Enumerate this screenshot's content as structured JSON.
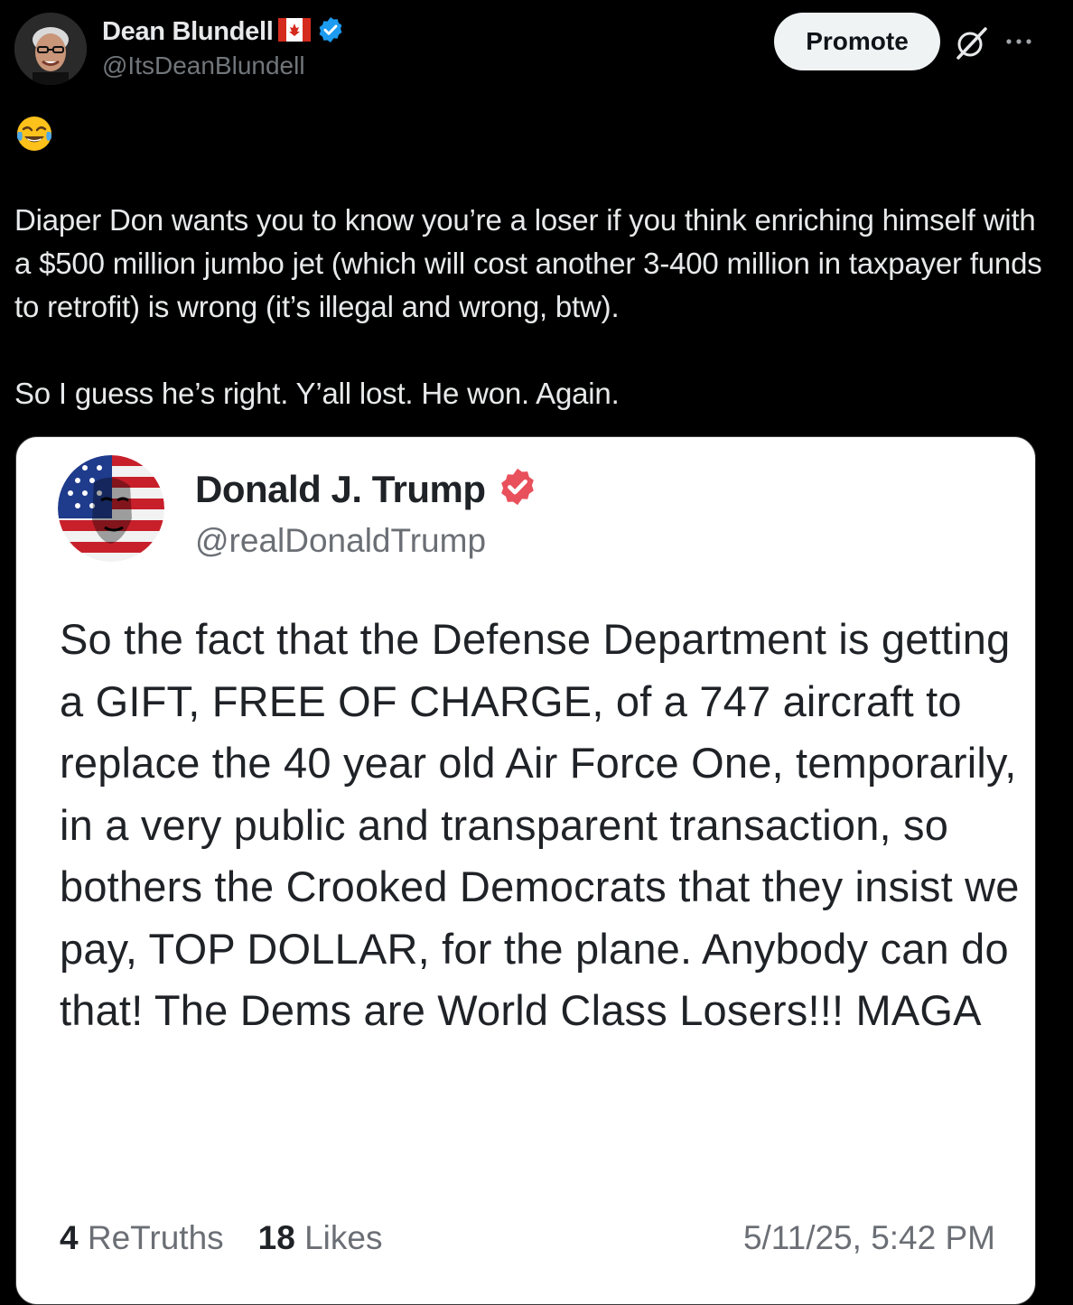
{
  "post": {
    "author_name": "Dean Blundell",
    "author_handle": "@ItsDeanBlundell",
    "promote_label": "Promote",
    "emoji": "😂",
    "paragraph_1": "Diaper Don wants you to know you’re a loser if you think enriching himself with a $500 million jumbo jet (which will cost another 3-400 million in taxpayer funds to retrofit) is wrong (it’s illegal and wrong, btw).",
    "paragraph_2": "So I guess he’s right. Y’all lost. He won. Again."
  },
  "quoted": {
    "author_name": "Donald J. Trump",
    "author_handle": "@realDonaldTrump",
    "text": "So the fact that the Defense Department is getting a GIFT, FREE OF CHARGE, of a 747 aircraft to replace the 40 year old Air Force One, temporarily, in a very public and transparent transaction, so bothers the Crooked Democrats that they insist we pay, TOP DOLLAR, for the plane. Anybody can do that! The Dems are World Class Losers!!! MAGA",
    "retruths_count": "4",
    "retruths_label": "ReTruths",
    "likes_count": "18",
    "likes_label": "Likes",
    "timestamp": "5/11/25, 5:42 PM"
  },
  "colors": {
    "background": "#000000",
    "verified_blue": "#1d9bf0",
    "truth_badge": "#e8505b",
    "promote_bg": "#eff3f4"
  },
  "icons": [
    "verified-badge-icon",
    "canada-flag-icon",
    "grok-icon",
    "more-icon",
    "truth-verified-icon"
  ]
}
